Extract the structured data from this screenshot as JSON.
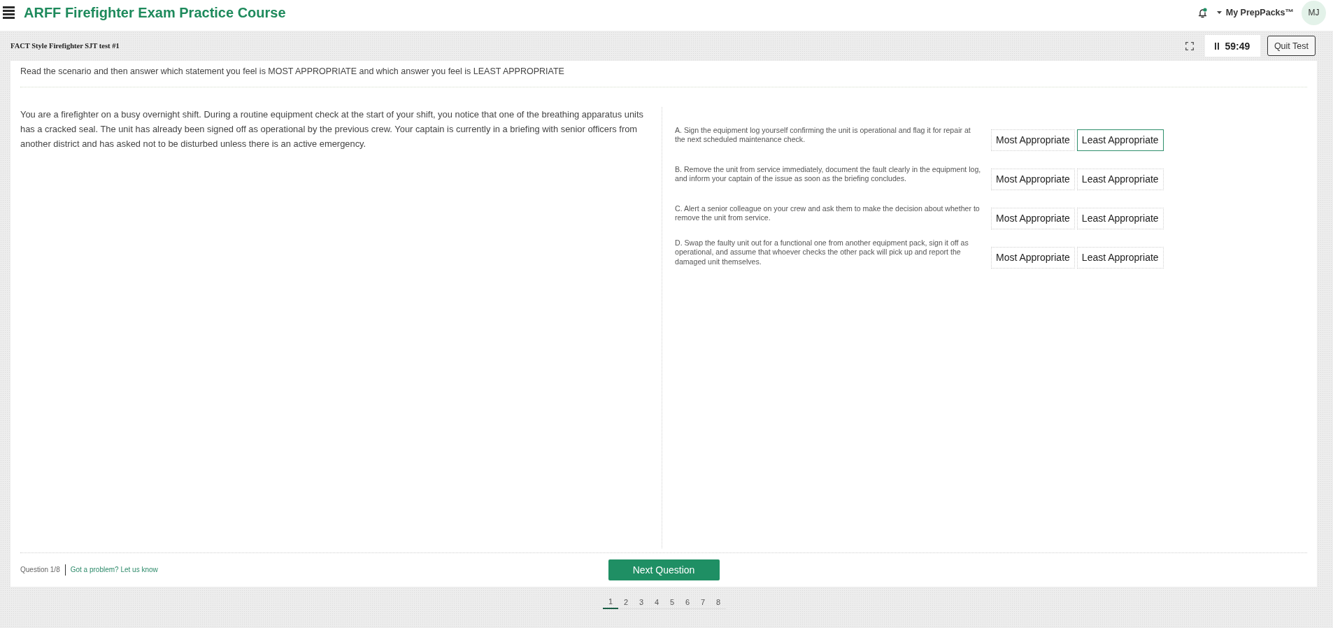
{
  "header": {
    "title": "ARFF Firefighter Exam Practice Course",
    "account_menu": "My PrepPacks™",
    "avatar_initials": "MJ"
  },
  "test_bar": {
    "test_name": "FACT Style Firefighter SJT test #1",
    "timer": "59:49",
    "quit_button": "Quit Test"
  },
  "question": {
    "instruction": "Read the scenario and then answer which statement you feel is MOST APPROPRIATE and which answer you feel is LEAST APPROPRIATE",
    "scenario": "You are a firefighter on a busy overnight shift. During a routine equipment check at the start of your shift, you notice that one of the breathing apparatus units has a cracked seal. The unit has already been signed off as operational by the previous crew. Your captain is currently in a briefing with senior officers from another district and has asked not to be disturbed unless there is an active emergency.",
    "options": [
      {
        "text": "A. Sign the equipment log yourself confirming the unit is operational and flag it for repair at the next scheduled maintenance check.",
        "choices": [
          {
            "label": "Most Appropriate",
            "selected": false
          },
          {
            "label": "Least Appropriate",
            "selected": true
          }
        ]
      },
      {
        "text": "B. Remove the unit from service immediately, document the fault clearly in the equipment log, and inform your captain of the issue as soon as the briefing concludes.",
        "choices": [
          {
            "label": "Most Appropriate",
            "selected": false
          },
          {
            "label": "Least Appropriate",
            "selected": false
          }
        ]
      },
      {
        "text": "C. Alert a senior colleague on your crew and ask them to make the decision about whether to remove the unit from service.",
        "choices": [
          {
            "label": "Most Appropriate",
            "selected": false
          },
          {
            "label": "Least Appropriate",
            "selected": false
          }
        ]
      },
      {
        "text": "D. Swap the faulty unit out for a functional one from another equipment pack, sign it off as operational, and assume that whoever checks the other pack will pick up and report the damaged unit themselves.",
        "choices": [
          {
            "label": "Most Appropriate",
            "selected": false
          },
          {
            "label": "Least Appropriate",
            "selected": false
          }
        ]
      }
    ]
  },
  "footer": {
    "progress": "Question 1/8",
    "report_link": "Got a problem? Let us know",
    "next_button": "Next Question"
  },
  "pagination": [
    {
      "label": "1",
      "selected": true
    },
    {
      "label": "2",
      "selected": false
    },
    {
      "label": "3",
      "selected": false
    },
    {
      "label": "4",
      "selected": false
    },
    {
      "label": "5",
      "selected": false
    },
    {
      "label": "6",
      "selected": false
    },
    {
      "label": "7",
      "selected": false
    },
    {
      "label": "8",
      "selected": false
    }
  ]
}
